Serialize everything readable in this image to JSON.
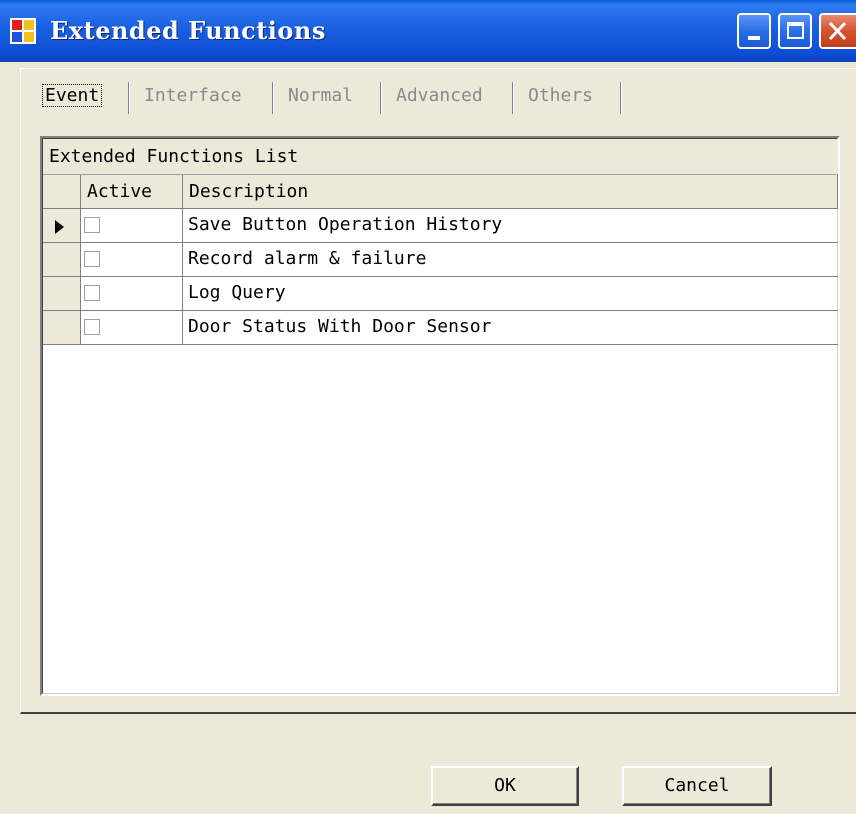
{
  "window": {
    "title": "Extended Functions",
    "icon": "app-window-icon",
    "controls": {
      "minimize": "minimize-icon",
      "maximize": "maximize-icon",
      "close": "close-icon"
    }
  },
  "tabs": [
    {
      "label": "Event",
      "active": true
    },
    {
      "label": "Interface",
      "active": false
    },
    {
      "label": "Normal",
      "active": false
    },
    {
      "label": "Advanced",
      "active": false
    },
    {
      "label": "Others",
      "active": false
    }
  ],
  "table": {
    "caption": "Extended Functions List",
    "columns": {
      "active": "Active",
      "description": "Description"
    },
    "rows": [
      {
        "active": false,
        "description": "Save Button Operation History",
        "current": true
      },
      {
        "active": false,
        "description": "Record alarm & failure"
      },
      {
        "active": false,
        "description": "Log Query"
      },
      {
        "active": false,
        "description": "Door Status With Door Sensor"
      }
    ]
  },
  "buttons": {
    "ok": "OK",
    "cancel": "Cancel"
  },
  "colors": {
    "titlebar": "#0b4fd4",
    "window_bg": "#ece9d8",
    "close_button": "#d5532f"
  }
}
